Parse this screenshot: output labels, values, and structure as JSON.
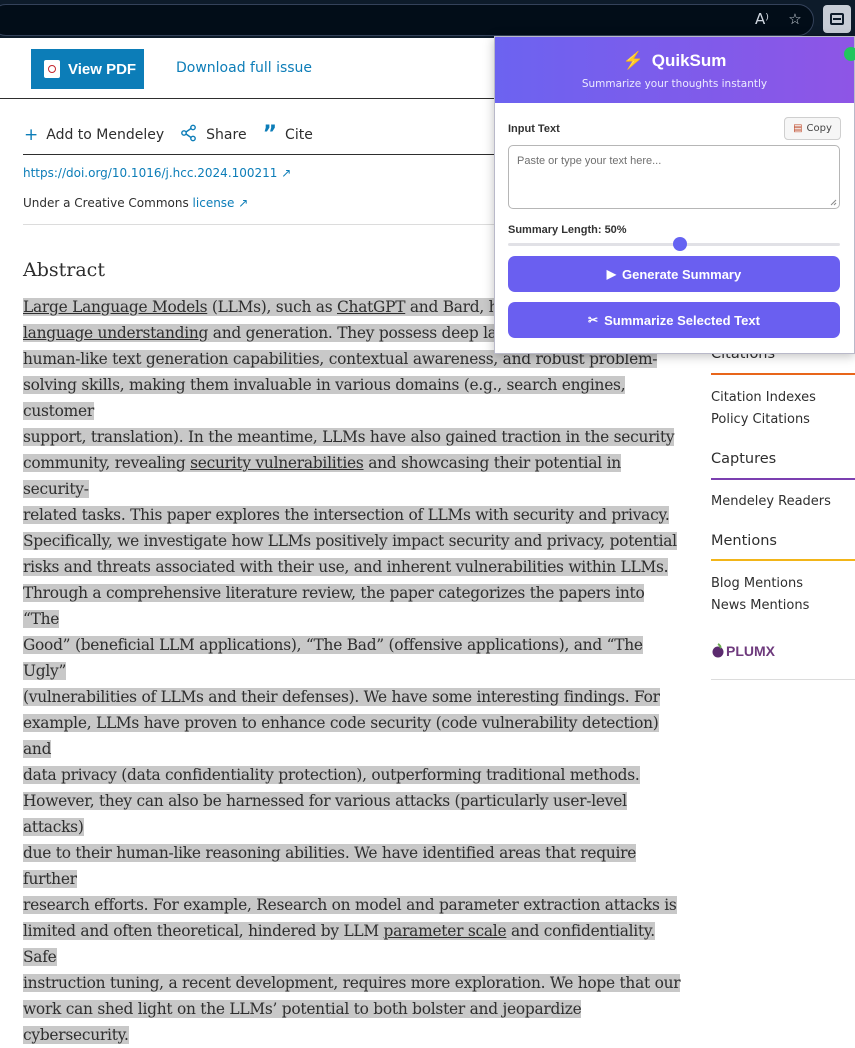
{
  "browser": {
    "read_aloud_icon": "A⁾",
    "favorite_icon": "☆"
  },
  "article": {
    "view_pdf_label": "View PDF",
    "download_label": "Download full issue",
    "actions": [
      {
        "icon": "+",
        "label": "Add to Mendeley"
      },
      {
        "icon": "share",
        "label": "Share"
      },
      {
        "icon": "”",
        "label": "Cite"
      }
    ],
    "doi": "https://doi.org/10.1016/j.hcc.2024.100211 ↗",
    "license_prefix": "Under a Creative Commons ",
    "license_link": "license ↗",
    "abstract_title": "Abstract",
    "abstract_lines": [
      "<u>Large Language Models</u> (LLMs), such as <u>ChatGPT</u> and Bard, have",
      "<u>language understanding</u> and generation. They possess deep lang",
      "human-like text generation capabilities, contextual awareness, and robust problem-",
      "solving skills, making them invaluable in various domains (e.g., search engines, customer",
      "support, translation). In the meantime, LLMs have also gained traction in the security",
      "community, revealing <u>security vulnerabilities</u> and showcasing their potential in security-",
      "related tasks. This paper explores the intersection of LLMs with security and privacy.",
      "Specifically, we investigate how LLMs positively impact security and privacy, potential",
      "risks and threats associated with their use, and inherent vulnerabilities within LLMs.",
      "Through a comprehensive literature review, the paper categorizes the papers into “The",
      "Good” (beneficial LLM applications), “The Bad” (offensive applications), and “The Ugly”",
      "(vulnerabilities of LLMs and their defenses). We have some interesting findings. For",
      "example, LLMs have proven to enhance code security (code vulnerability detection) and",
      "data privacy (data confidentiality protection), outperforming traditional methods.",
      "However, they can also be harnessed for various attacks (particularly user-level attacks)",
      "due to their human-like reasoning abilities. We have identified areas that require further",
      "research efforts. For example, Research on model and parameter extraction attacks is",
      "limited and often theoretical, hindered by LLM <u>parameter scale</u> and confidentiality. Safe",
      "instruction tuning, a recent development, requires more exploration. We hope that our",
      "work can shed light on the LLMs’ potential to both bolster and jeopardize cybersecurity."
    ]
  },
  "sidebar": {
    "citations_heading": "Citations",
    "citations_items": [
      "Citation Indexes",
      "Policy Citations"
    ],
    "captures_heading": "Captures",
    "captures_items": [
      "Mendeley Readers"
    ],
    "mentions_heading": "Mentions",
    "mentions_items": [
      "Blog Mentions",
      "News Mentions"
    ],
    "plumx_logo": "PLUMX",
    "colors": {
      "citations": "#e8651a",
      "captures": "#7b3fb0",
      "mentions": "#f2b518"
    }
  },
  "popup": {
    "title": "QuikSum",
    "subtitle": "Summarize your thoughts instantly",
    "input_label": "Input Text",
    "copy_label": "Copy",
    "input_placeholder": "Paste or type your text here...",
    "summary_length_label": "Summary Length: 50%",
    "summary_length_value": 0.5,
    "generate_label": "Generate Summary",
    "selected_label": "Summarize Selected Text",
    "colors": {
      "header_start": "#6c63f0",
      "header_end": "#8e55e6",
      "button": "#6a5ff0",
      "bolt": "#f59a2a"
    }
  }
}
